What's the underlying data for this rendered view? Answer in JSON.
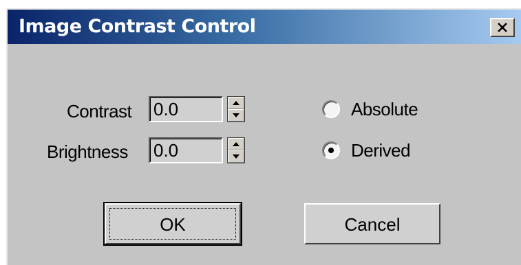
{
  "window": {
    "title": "Image Contrast Control"
  },
  "controls": {
    "contrast": {
      "label": "Contrast",
      "value": "0.0"
    },
    "brightness": {
      "label": "Brightness",
      "value": "0.0"
    }
  },
  "mode": {
    "options": [
      {
        "label": "Absolute",
        "selected": false
      },
      {
        "label": "Derived",
        "selected": true
      }
    ]
  },
  "buttons": {
    "ok": "OK",
    "cancel": "Cancel"
  }
}
